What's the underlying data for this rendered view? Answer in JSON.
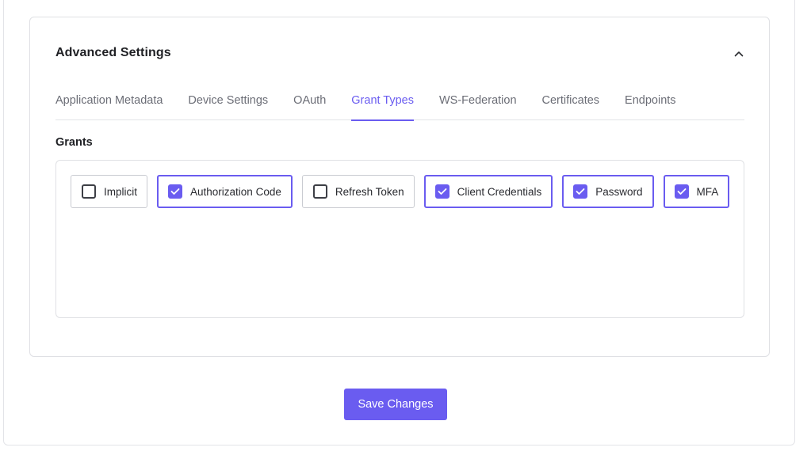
{
  "card": {
    "title": "Advanced Settings"
  },
  "tabs": [
    {
      "label": "Application Metadata",
      "active": false
    },
    {
      "label": "Device Settings",
      "active": false
    },
    {
      "label": "OAuth",
      "active": false
    },
    {
      "label": "Grant Types",
      "active": true
    },
    {
      "label": "WS-Federation",
      "active": false
    },
    {
      "label": "Certificates",
      "active": false
    },
    {
      "label": "Endpoints",
      "active": false
    }
  ],
  "grants": {
    "label": "Grants",
    "items": [
      {
        "label": "Implicit",
        "checked": false
      },
      {
        "label": "Authorization Code",
        "checked": true
      },
      {
        "label": "Refresh Token",
        "checked": false
      },
      {
        "label": "Client Credentials",
        "checked": true
      },
      {
        "label": "Password",
        "checked": true
      },
      {
        "label": "MFA",
        "checked": true
      }
    ]
  },
  "actions": {
    "save_label": "Save Changes"
  },
  "colors": {
    "accent": "#6a5cf0",
    "border": "#dfe0e4",
    "tab_inactive": "#6b6d76"
  }
}
